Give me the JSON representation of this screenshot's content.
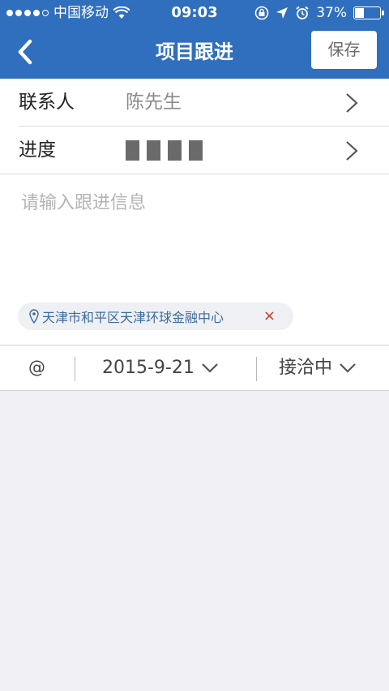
{
  "status_bar": {
    "carrier": "中国移动",
    "time": "09:03",
    "battery": "37%"
  },
  "nav": {
    "title": "项目跟进",
    "save_label": "保存"
  },
  "form": {
    "contact_label": "联系人",
    "contact_value": "陈先生",
    "progress_label": "进度",
    "progress_segments": 4,
    "note_placeholder": "请输入跟进信息",
    "location": "天津市和平区天津环球金融中心",
    "location_remove": "×"
  },
  "toolbar": {
    "at_label": "@",
    "date": "2015-9-21",
    "status": "接洽中"
  },
  "colors": {
    "nav_bar": "#2f6fbd",
    "location_text": "#3d6b9e",
    "remove_icon": "#c0392b",
    "background": "#efeff4"
  }
}
